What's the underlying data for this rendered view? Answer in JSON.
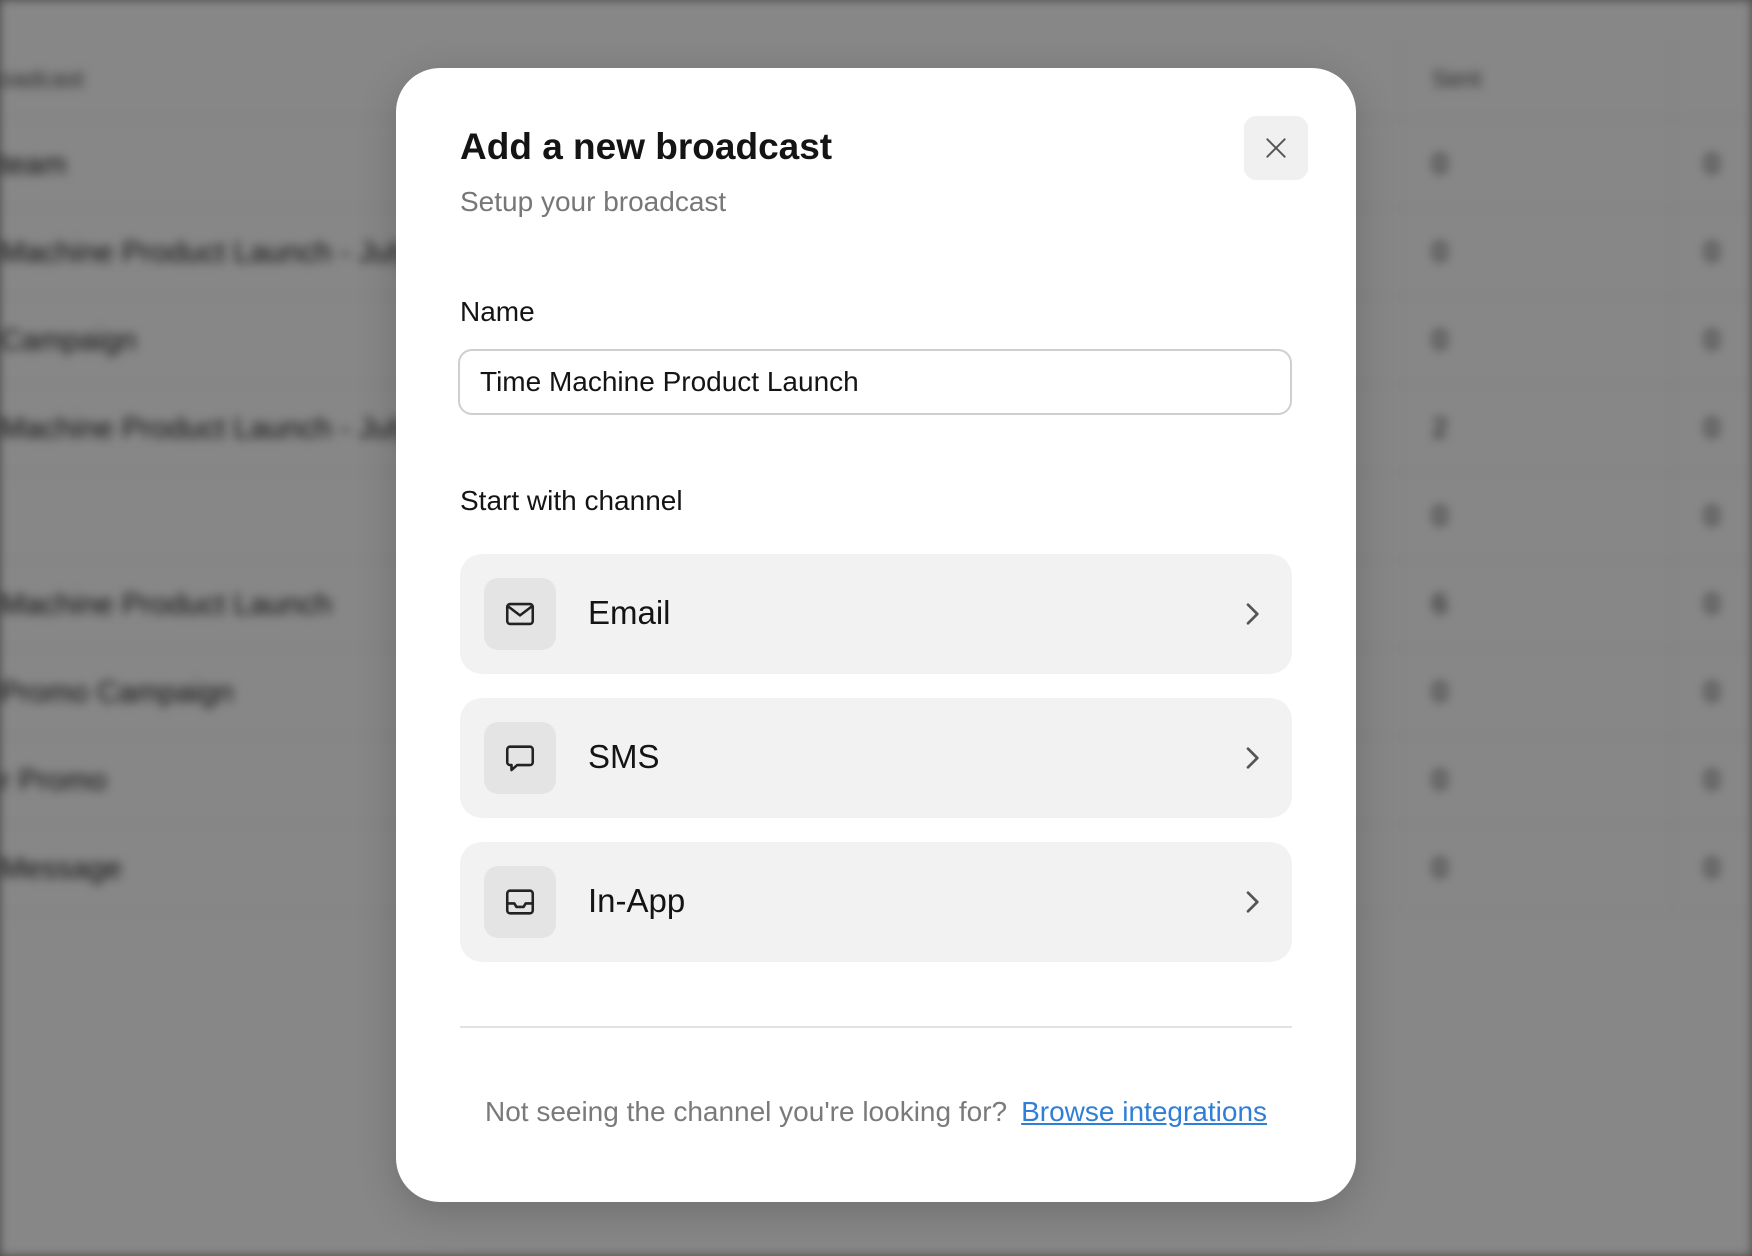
{
  "background": {
    "columns": [
      "oadcast",
      "Sent"
    ],
    "rows": [
      {
        "name": "team",
        "sent": "0",
        "other": "0"
      },
      {
        "name": "Machine Product Launch - July",
        "sent": "0",
        "other": "0"
      },
      {
        "name": "Campaign",
        "sent": "0",
        "other": "0"
      },
      {
        "name": "Machine Product Launch - July",
        "sent": "2",
        "other": "0"
      },
      {
        "name": "",
        "sent": "0",
        "other": "0"
      },
      {
        "name": "Machine Product Launch",
        "sent": "6",
        "other": "0"
      },
      {
        "name": "Promo Campaign",
        "sent": "0",
        "other": "0"
      },
      {
        "name": "r Promo",
        "sent": "0",
        "other": "0"
      },
      {
        "name": "Message",
        "sent": "0",
        "other": "0"
      }
    ]
  },
  "modal": {
    "title": "Add a new broadcast",
    "subtitle": "Setup your broadcast",
    "close_icon": "close-icon",
    "name_label": "Name",
    "name_value": "Time Machine Product Launch",
    "channel_label": "Start with channel",
    "channels": [
      {
        "label": "Email",
        "icon": "mail-icon"
      },
      {
        "label": "SMS",
        "icon": "message-icon"
      },
      {
        "label": "In-App",
        "icon": "inbox-icon"
      }
    ],
    "footer_text": "Not seeing the channel you're looking for?",
    "footer_link": "Browse integrations"
  },
  "colors": {
    "overlay": "#000000",
    "link": "#2f7fd8",
    "card": "#f2f2f2"
  }
}
